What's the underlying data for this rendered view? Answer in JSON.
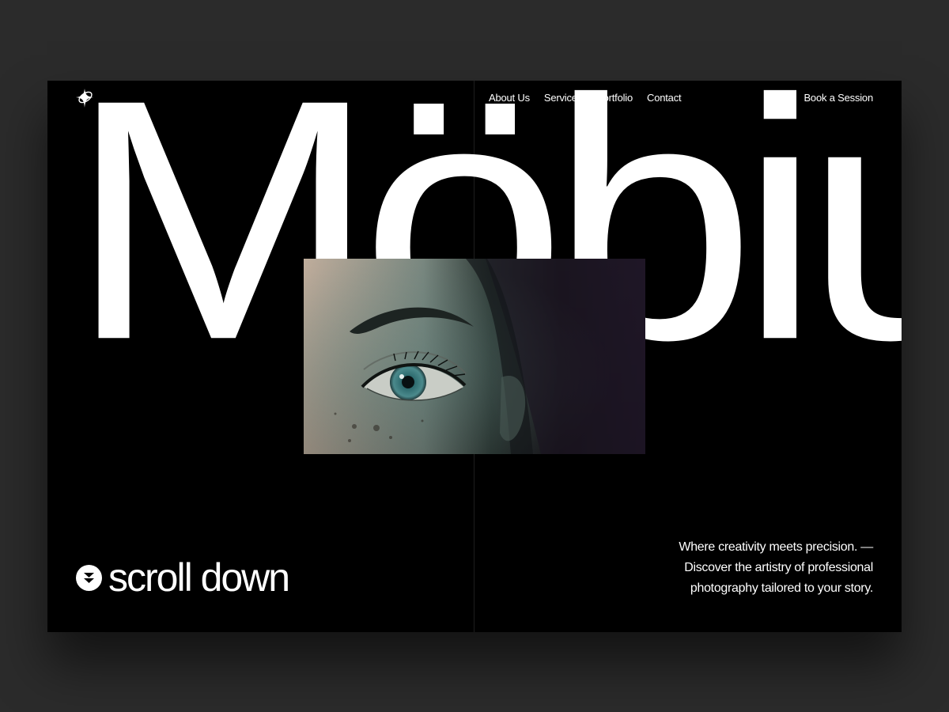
{
  "header": {
    "logo_icon": "sparkle-star-icon",
    "nav": [
      {
        "label": "About Us"
      },
      {
        "label": "Services"
      },
      {
        "label": "Portfolio"
      },
      {
        "label": "Contact"
      }
    ],
    "cta_label": "Book a Session"
  },
  "hero": {
    "word": "Möbius",
    "photo_icon": "eye-photo"
  },
  "footer": {
    "scroll_icon": "chevron-double-down-icon",
    "scroll_label": "scroll down",
    "tagline_lines": [
      "Where creativity meets precision. —",
      "Discover the artistry of professional",
      "photography tailored to your story."
    ]
  },
  "colors": {
    "background": "#000000",
    "outer": "#2b2b2b",
    "text": "#ffffff"
  }
}
